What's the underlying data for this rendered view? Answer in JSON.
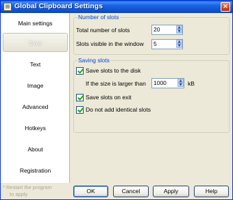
{
  "window": {
    "title": "Global Clipboard Settings",
    "close_label": "×"
  },
  "sidebar": {
    "items": [
      {
        "label": "Main settings"
      },
      {
        "label": "Slots"
      },
      {
        "label": "Text"
      },
      {
        "label": "Image"
      },
      {
        "label": "Advanced"
      },
      {
        "label": "Hotkeys"
      },
      {
        "label": "About"
      },
      {
        "label": "Registration"
      }
    ],
    "selected": "Slots",
    "restart_note_line1": "* Restart the program",
    "restart_note_line2": "to apply"
  },
  "number_of_slots": {
    "title": "Number of slots",
    "total_label": "Total number of slots",
    "total_value": "20",
    "visible_label": "Slots visible in the window",
    "visible_value": "5"
  },
  "saving_slots": {
    "title": "Saving slots",
    "save_to_disk": {
      "label": "Save slots to the disk",
      "checked": true
    },
    "size_label": "If the size is larger than",
    "size_value": "1000",
    "size_unit": "kB",
    "save_on_exit": {
      "label": "Save slots on exit",
      "checked": true
    },
    "no_identical": {
      "label": "Do not add identical slots",
      "checked": true
    }
  },
  "buttons": {
    "ok": "OK",
    "cancel": "Cancel",
    "apply": "Apply",
    "help": "Help"
  },
  "icons": {
    "spin_up": "▲",
    "spin_down": "▼"
  }
}
